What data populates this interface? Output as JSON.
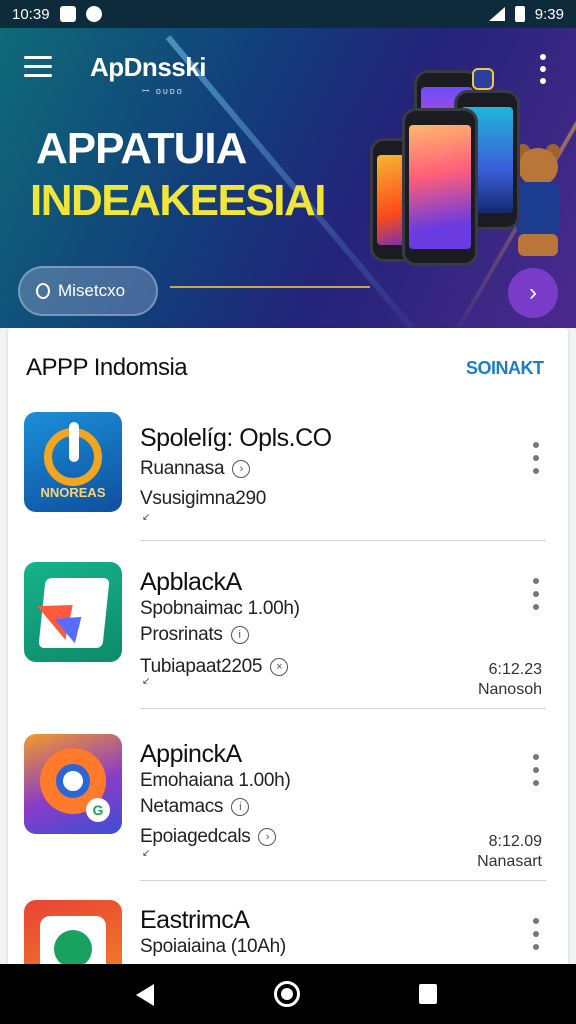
{
  "status_bar": {
    "time_left": "10:39",
    "time_right": "9:39"
  },
  "header": {
    "app_title": "ApDnsski",
    "app_subtitle": "ꟷ ᴏᴜᴅᴏ",
    "hero_line1": "APPATUIA",
    "hero_line2": "INDEAKEESIAI",
    "pill_label": "Misetcxo"
  },
  "section": {
    "title": "APPP Indomsia",
    "action_label": "SOINAKT"
  },
  "apps": [
    {
      "name": "Spolelíg: Opls.CO",
      "line2": "Ruannasa",
      "line3": "Vsusigimna290",
      "line4": "",
      "date_time": "",
      "date_label": "",
      "icon_text": "NNOREAS"
    },
    {
      "name": "ApblackA",
      "line2": "Spobnaimac 1.00h)",
      "line3": "Prosrinats",
      "line4": "Tubiapaat2205",
      "date_time": "6:12.23",
      "date_label": "Nanosoh",
      "icon_text": ""
    },
    {
      "name": "AppinckA",
      "line2": "Emohaiana 1.00h)",
      "line3": "Netamacs",
      "line4": "Epoiagedcals",
      "date_time": "8:12.09",
      "date_label": "Nanasart",
      "icon_text": ""
    },
    {
      "name": "EastrimcA",
      "line2": "Spoiaiaina (10Ah)",
      "line3": "",
      "line4": "",
      "date_time": "",
      "date_label": "",
      "icon_text": ""
    }
  ]
}
